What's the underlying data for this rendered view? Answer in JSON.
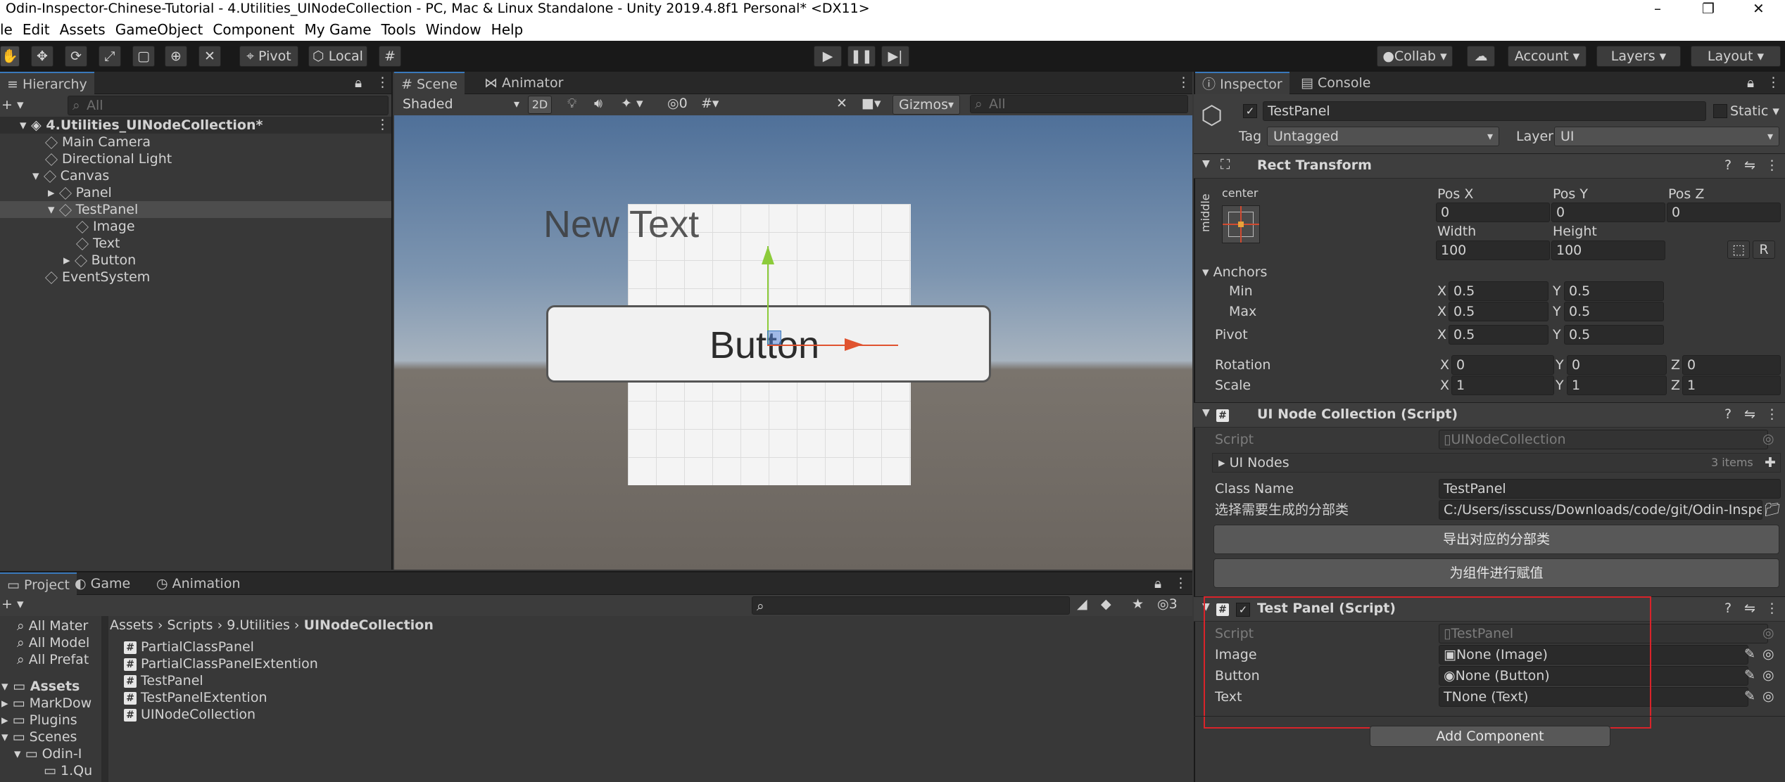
{
  "window": {
    "title": "Odin-Inspector-Chinese-Tutorial - 4.Utilities_UINodeCollection - PC, Mac & Linux Standalone - Unity 2019.4.8f1 Personal* <DX11>",
    "minimize": "–",
    "maximize": "❐",
    "close": "✕"
  },
  "menu": [
    "le",
    "Edit",
    "Assets",
    "GameObject",
    "Component",
    "My Game",
    "Tools",
    "Window",
    "Help"
  ],
  "toolbar": {
    "pivot": "Pivot",
    "local": "Local",
    "collab": "Collab",
    "account": "Account",
    "layers": "Layers",
    "layout": "Layout"
  },
  "hierarchy": {
    "tab": "Hierarchy",
    "search_placeholder": "All",
    "scene": "4.Utilities_UINodeCollection*",
    "items": [
      "Main Camera",
      "Directional Light",
      "Canvas",
      "Panel",
      "TestPanel",
      "Image",
      "Text",
      "Button",
      "EventSystem"
    ]
  },
  "scene": {
    "tabs": [
      "Scene",
      "Animator"
    ],
    "shading": "Shaded",
    "mode2d": "2D",
    "hidden_count": "0",
    "gizmos": "Gizmos",
    "search_placeholder": "All",
    "new_text": "New Text",
    "button_text": "Button"
  },
  "project": {
    "tabs": [
      "Project",
      "Game",
      "Animation"
    ],
    "hidden_count": "3",
    "favorites": [
      "All Mater",
      "All Model",
      "All Prefat"
    ],
    "tree": [
      "Assets",
      "MarkDow",
      "Plugins",
      "Scenes",
      "Odin-I",
      "1.Qu"
    ],
    "breadcrumb": [
      "Assets",
      "Scripts",
      "9.Utilities",
      "UINodeCollection"
    ],
    "files": [
      "PartialClassPanel",
      "PartialClassPanelExtention",
      "TestPanel",
      "TestPanelExtention",
      "UINodeCollection"
    ]
  },
  "inspector": {
    "tabs": [
      "Inspector",
      "Console"
    ],
    "object_name": "TestPanel",
    "static_label": "Static",
    "tag_label": "Tag",
    "tag_value": "Untagged",
    "layer_label": "Layer",
    "layer_value": "UI",
    "rect": {
      "title": "Rect Transform",
      "anchor_h": "center",
      "anchor_v": "middle",
      "labels": {
        "posx": "Pos X",
        "posy": "Pos Y",
        "posz": "Pos Z",
        "width": "Width",
        "height": "Height"
      },
      "posx": "0",
      "posy": "0",
      "posz": "0",
      "width": "100",
      "height": "100",
      "r_btn": "R",
      "anchors": "Anchors",
      "min": "Min",
      "max": "Max",
      "pivot": "Pivot",
      "x": "X",
      "y": "Y",
      "z": "Z",
      "min_x": "0.5",
      "min_y": "0.5",
      "max_x": "0.5",
      "max_y": "0.5",
      "pivot_x": "0.5",
      "pivot_y": "0.5",
      "rotation": "Rotation",
      "scale": "Scale",
      "rot_x": "0",
      "rot_y": "0",
      "rot_z": "0",
      "scale_x": "1",
      "scale_y": "1",
      "scale_z": "1"
    },
    "uinode": {
      "title": "UI Node Collection (Script)",
      "script_label": "Script",
      "script_value": "UINodeCollection",
      "ui_nodes": "UI Nodes",
      "items_count": "3 items",
      "class_name_label": "Class Name",
      "class_name_value": "TestPanel",
      "path_label": "选择需要生成的分部类",
      "path_value": "C:/Users/isscuss/Downloads/code/git/Odin-Inspect",
      "export_button": "导出对应的分部类",
      "assign_button": "为组件进行赋值"
    },
    "testpanel": {
      "title": "Test Panel (Script)",
      "script_label": "Script",
      "script_value": "TestPanel",
      "image_label": "Image",
      "image_value": "None (Image)",
      "button_label": "Button",
      "button_value": "None (Button)",
      "text_label": "Text",
      "text_value": "None (Text)"
    },
    "add_component": "Add Component"
  },
  "colors": {
    "accent": "#3a79bb",
    "highlight_box": "#d9232a"
  }
}
